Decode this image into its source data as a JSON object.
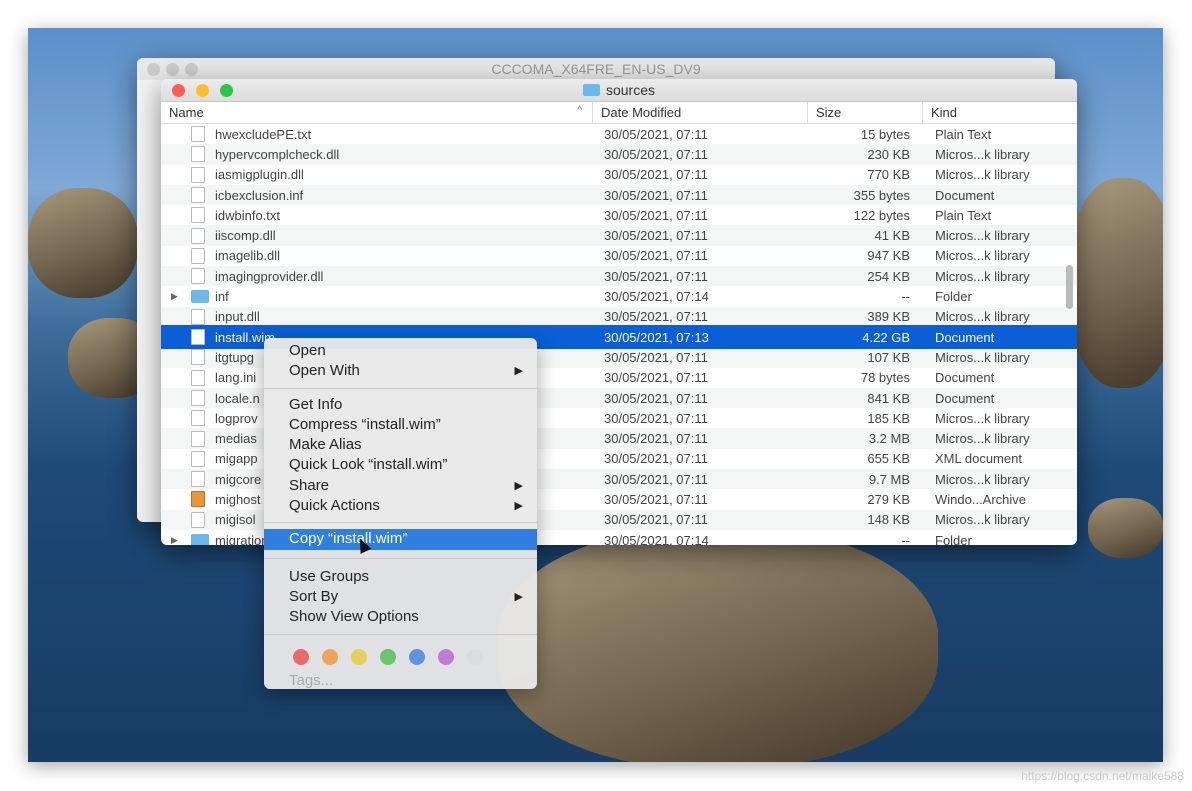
{
  "back_window": {
    "title": "CCCOMA_X64FRE_EN-US_DV9"
  },
  "window": {
    "title": "sources"
  },
  "columns": [
    "Name",
    "Date Modified",
    "Size",
    "Kind"
  ],
  "rows": [
    {
      "name": "hwexcludePE.txt",
      "date": "30/05/2021, 07:11",
      "size": "15 bytes",
      "kind": "Plain Text",
      "icon": "file"
    },
    {
      "name": "hypervcomplcheck.dll",
      "date": "30/05/2021, 07:11",
      "size": "230 KB",
      "kind": "Micros...k library",
      "icon": "file"
    },
    {
      "name": "iasmigplugin.dll",
      "date": "30/05/2021, 07:11",
      "size": "770 KB",
      "kind": "Micros...k library",
      "icon": "file"
    },
    {
      "name": "icbexclusion.inf",
      "date": "30/05/2021, 07:11",
      "size": "355 bytes",
      "kind": "Document",
      "icon": "file"
    },
    {
      "name": "idwbinfo.txt",
      "date": "30/05/2021, 07:11",
      "size": "122 bytes",
      "kind": "Plain Text",
      "icon": "file"
    },
    {
      "name": "iiscomp.dll",
      "date": "30/05/2021, 07:11",
      "size": "41 KB",
      "kind": "Micros...k library",
      "icon": "file"
    },
    {
      "name": "imagelib.dll",
      "date": "30/05/2021, 07:11",
      "size": "947 KB",
      "kind": "Micros...k library",
      "icon": "file"
    },
    {
      "name": "imagingprovider.dll",
      "date": "30/05/2021, 07:11",
      "size": "254 KB",
      "kind": "Micros...k library",
      "icon": "file"
    },
    {
      "name": "inf",
      "date": "30/05/2021, 07:14",
      "size": "--",
      "kind": "Folder",
      "icon": "folder"
    },
    {
      "name": "input.dll",
      "date": "30/05/2021, 07:11",
      "size": "389 KB",
      "kind": "Micros...k library",
      "icon": "file"
    },
    {
      "name": "install.wim",
      "date": "30/05/2021, 07:13",
      "size": "4.22 GB",
      "kind": "Document",
      "icon": "file",
      "selected": true
    },
    {
      "name": "itgtupg",
      "date": "30/05/2021, 07:11",
      "size": "107 KB",
      "kind": "Micros...k library",
      "icon": "file"
    },
    {
      "name": "lang.ini",
      "date": "30/05/2021, 07:11",
      "size": "78 bytes",
      "kind": "Document",
      "icon": "file"
    },
    {
      "name": "locale.n",
      "date": "30/05/2021, 07:11",
      "size": "841 KB",
      "kind": "Document",
      "icon": "file"
    },
    {
      "name": "logprov",
      "date": "30/05/2021, 07:11",
      "size": "185 KB",
      "kind": "Micros...k library",
      "icon": "file"
    },
    {
      "name": "medias",
      "date": "30/05/2021, 07:11",
      "size": "3.2 MB",
      "kind": "Micros...k library",
      "icon": "file"
    },
    {
      "name": "migapp",
      "date": "30/05/2021, 07:11",
      "size": "655 KB",
      "kind": "XML document",
      "icon": "file"
    },
    {
      "name": "migcore",
      "date": "30/05/2021, 07:11",
      "size": "9.7 MB",
      "kind": "Micros...k library",
      "icon": "file"
    },
    {
      "name": "mighost",
      "date": "30/05/2021, 07:11",
      "size": "279 KB",
      "kind": "Windo...Archive",
      "icon": "archive"
    },
    {
      "name": "migisol",
      "date": "30/05/2021, 07:11",
      "size": "148 KB",
      "kind": "Micros...k library",
      "icon": "file"
    },
    {
      "name": "migration",
      "date": "30/05/2021, 07:14",
      "size": "--",
      "kind": "Folder",
      "icon": "folder"
    }
  ],
  "menu": {
    "group1": [
      "Open",
      "Open With"
    ],
    "group2": [
      "Get Info",
      "Compress “install.wim”",
      "Make Alias",
      "Quick Look “install.wim”",
      "Share",
      "Quick Actions"
    ],
    "copy": "Copy “install.wim”",
    "group3": [
      "Use Groups",
      "Sort By",
      "Show View Options"
    ],
    "tag_colors": [
      "#e86b6b",
      "#eea45a",
      "#e8cf5a",
      "#6cc46c",
      "#5f95e0",
      "#c07ad8",
      "#dcdcdc"
    ],
    "tags_label": "Tags..."
  },
  "watermark": "https://blog.csdn.net/maike588"
}
